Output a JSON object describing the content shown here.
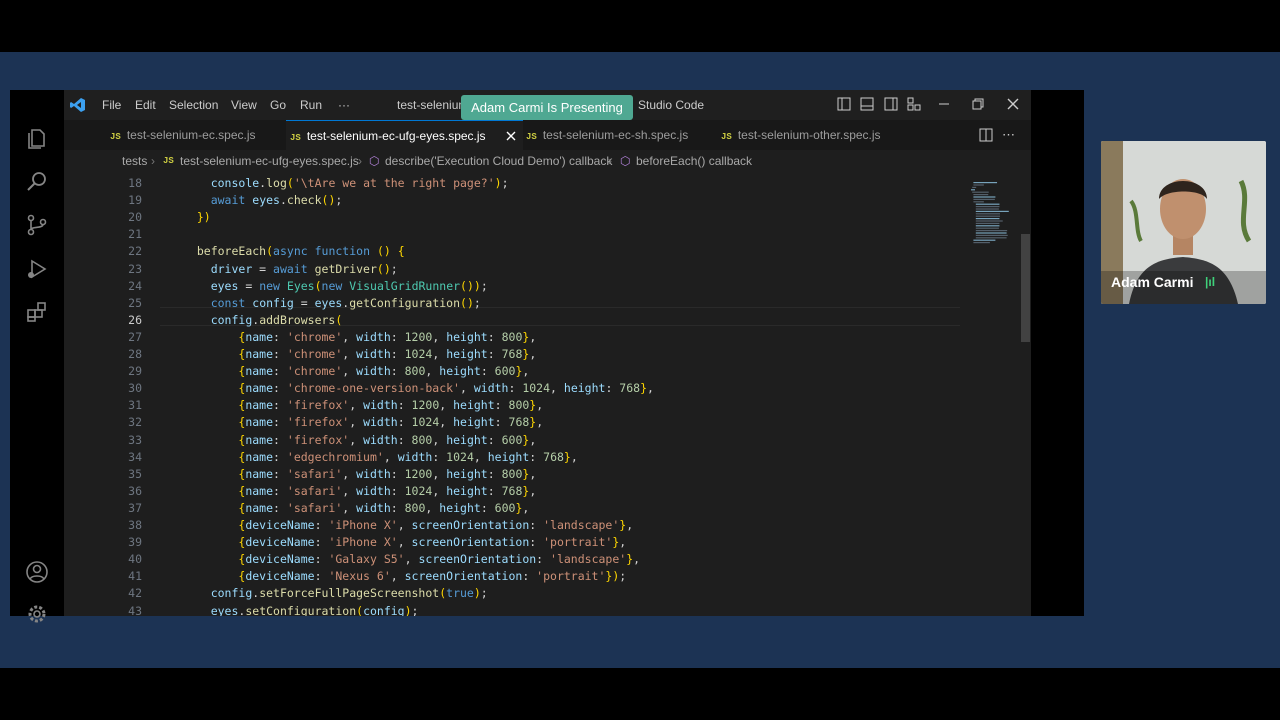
{
  "window": {
    "menu": [
      "File",
      "Edit",
      "Selection",
      "View",
      "Go",
      "Run",
      "···"
    ],
    "title_prefix": "test-selenium",
    "title_suffix": "Studio Code",
    "presenting_banner": "Adam Carmi Is Presenting"
  },
  "tabs": [
    {
      "badge": "JS",
      "label": "test-selenium-ec.spec.js",
      "active": false
    },
    {
      "badge": "JS",
      "label": "test-selenium-ec-ufg-eyes.spec.js",
      "active": true
    },
    {
      "badge": "JS",
      "label": "test-selenium-ec-sh.spec.js",
      "active": false
    },
    {
      "badge": "JS",
      "label": "test-selenium-other.spec.js",
      "active": false
    }
  ],
  "breadcrumb": {
    "folder": "tests",
    "file": "test-selenium-ec-ufg-eyes.spec.js",
    "describe": "describe('Execution Cloud Demo') callback",
    "before_each": "beforeEach() callback"
  },
  "editor": {
    "current_line": "26",
    "lines": [
      {
        "n": "18",
        "text": "    console.log('\\tAre we at the right page?');"
      },
      {
        "n": "19",
        "text": "    await eyes.check();"
      },
      {
        "n": "20",
        "text": "  })"
      },
      {
        "n": "21",
        "text": ""
      },
      {
        "n": "22",
        "text": "  beforeEach(async function () {"
      },
      {
        "n": "23",
        "text": "    driver = await getDriver();"
      },
      {
        "n": "24",
        "text": "    eyes = new Eyes(new VisualGridRunner());"
      },
      {
        "n": "25",
        "text": "    const config = eyes.getConfiguration();"
      },
      {
        "n": "26",
        "text": "    config.addBrowsers("
      },
      {
        "n": "27",
        "text": "        {name: 'chrome', width: 1200, height: 800},"
      },
      {
        "n": "28",
        "text": "        {name: 'chrome', width: 1024, height: 768},"
      },
      {
        "n": "29",
        "text": "        {name: 'chrome', width: 800, height: 600},"
      },
      {
        "n": "30",
        "text": "        {name: 'chrome-one-version-back', width: 1024, height: 768},"
      },
      {
        "n": "31",
        "text": "        {name: 'firefox', width: 1200, height: 800},"
      },
      {
        "n": "32",
        "text": "        {name: 'firefox', width: 1024, height: 768},"
      },
      {
        "n": "33",
        "text": "        {name: 'firefox', width: 800, height: 600},"
      },
      {
        "n": "34",
        "text": "        {name: 'edgechromium', width: 1024, height: 768},"
      },
      {
        "n": "35",
        "text": "        {name: 'safari', width: 1200, height: 800},"
      },
      {
        "n": "36",
        "text": "        {name: 'safari', width: 1024, height: 768},"
      },
      {
        "n": "37",
        "text": "        {name: 'safari', width: 800, height: 600},"
      },
      {
        "n": "38",
        "text": "        {deviceName: 'iPhone X', screenOrientation: 'landscape'},"
      },
      {
        "n": "39",
        "text": "        {deviceName: 'iPhone X', screenOrientation: 'portrait'},"
      },
      {
        "n": "40",
        "text": "        {deviceName: 'Galaxy S5', screenOrientation: 'landscape'},"
      },
      {
        "n": "41",
        "text": "        {deviceName: 'Nexus 6', screenOrientation: 'portrait'});"
      },
      {
        "n": "42",
        "text": "    config.setForceFullPageScreenshot(true);"
      },
      {
        "n": "43",
        "text": "    eyes.setConfiguration(config);"
      }
    ]
  },
  "video": {
    "name": "Adam Carmi"
  },
  "colors": {
    "accent": "#0078d4",
    "banner": "#4fa892",
    "stage": "#1c3354"
  }
}
